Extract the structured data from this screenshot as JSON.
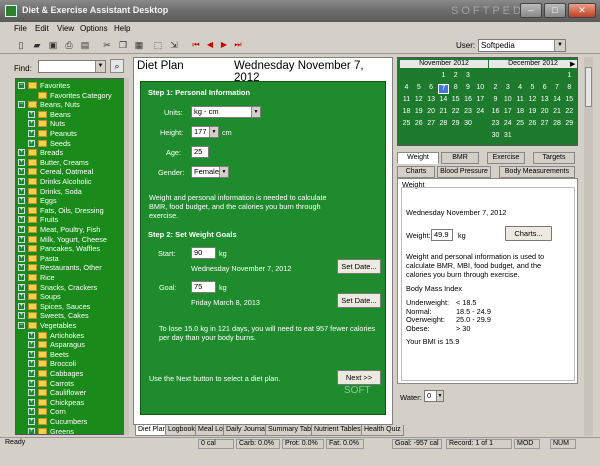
{
  "window": {
    "title": "Diet & Exercise Assistant Desktop",
    "watermark": "SOFTPEDIA",
    "watermark_small": "SOFT"
  },
  "menu": [
    "File",
    "Edit",
    "View",
    "Options",
    "Help"
  ],
  "user": {
    "label": "User:",
    "value": "Softpedia"
  },
  "find": {
    "label": "Find:"
  },
  "tree": [
    {
      "label": "Favorites",
      "level": 0,
      "expanded": true
    },
    {
      "label": "Favorites Category",
      "level": 1
    },
    {
      "label": "Beans, Nuts",
      "level": 0,
      "expanded": true
    },
    {
      "label": "Beans",
      "level": 1,
      "expandable": true
    },
    {
      "label": "Nuts",
      "level": 1,
      "expandable": true
    },
    {
      "label": "Peanuts",
      "level": 1,
      "expandable": true
    },
    {
      "label": "Seeds",
      "level": 1,
      "expandable": true
    },
    {
      "label": "Breads",
      "level": 0
    },
    {
      "label": "Butter, Creams",
      "level": 0
    },
    {
      "label": "Cereal, Oatmeal",
      "level": 0
    },
    {
      "label": "Drinks Alcoholic",
      "level": 0
    },
    {
      "label": "Drinks, Soda",
      "level": 0
    },
    {
      "label": "Eggs",
      "level": 0
    },
    {
      "label": "Fats, Oils, Dressing",
      "level": 0
    },
    {
      "label": "Fruits",
      "level": 0
    },
    {
      "label": "Meat, Poultry, Fish",
      "level": 0
    },
    {
      "label": "Milk, Yogurt, Cheese",
      "level": 0
    },
    {
      "label": "Pancakes, Waffles",
      "level": 0
    },
    {
      "label": "Pasta",
      "level": 0
    },
    {
      "label": "Restaurants, Other",
      "level": 0
    },
    {
      "label": "Rice",
      "level": 0
    },
    {
      "label": "Snacks, Crackers",
      "level": 0
    },
    {
      "label": "Soups",
      "level": 0
    },
    {
      "label": "Spices, Sauces",
      "level": 0
    },
    {
      "label": "Sweets, Cakes",
      "level": 0
    },
    {
      "label": "Vegetables",
      "level": 0,
      "expanded": true
    },
    {
      "label": "Artichokes",
      "level": 1,
      "expandable": true
    },
    {
      "label": "Asparagus",
      "level": 1,
      "expandable": true
    },
    {
      "label": "Beets",
      "level": 1,
      "expandable": true
    },
    {
      "label": "Broccoli",
      "level": 1,
      "expandable": true
    },
    {
      "label": "Cabbages",
      "level": 1,
      "expandable": true
    },
    {
      "label": "Carrots",
      "level": 1,
      "expandable": true
    },
    {
      "label": "Cauliflower",
      "level": 1,
      "expandable": true
    },
    {
      "label": "Chickpeas",
      "level": 1,
      "expandable": true
    },
    {
      "label": "Corn",
      "level": 1,
      "expandable": true
    },
    {
      "label": "Cucumbers",
      "level": 1,
      "expandable": true
    },
    {
      "label": "Greens",
      "level": 1,
      "expandable": true
    }
  ],
  "diet": {
    "title": "Diet Plan",
    "date": "Wednesday November 7, 2012",
    "step1": "Step 1:  Personal Information",
    "units_label": "Units:",
    "units_value": "kg - cm",
    "height_label": "Height:",
    "height_value": "177",
    "height_unit": "cm",
    "age_label": "Age:",
    "age_value": "25",
    "gender_label": "Gender:",
    "gender_value": "Female",
    "step1_note": "Weight and personal information is needed to calculate BMR, food budget, and the calories you burn through exercise.",
    "step2": "Step 2:  Set Weight Goals",
    "start_label": "Start:",
    "start_value": "90",
    "start_unit": "kg",
    "start_date": "Wednesday November 7, 2012",
    "goal_label": "Goal:",
    "goal_value": "75",
    "goal_unit": "kg",
    "goal_date": "Friday March 8, 2013",
    "set_date": "Set Date...",
    "summary": "To lose 15.0 kg in 121 days, you will need to eat 957 fewer calories per day than your body burns.",
    "next_note": "Use the Next button to select a diet plan.",
    "next_button": "Next >>"
  },
  "center_tabs": [
    "Diet Plan",
    "Logbook",
    "Meal Log",
    "Daily Journal",
    "Summary Table",
    "Nutrient Tables",
    "Health Quiz"
  ],
  "calendar": {
    "nov_title": "November 2012",
    "dec_title": "December 2012",
    "nov_rows": [
      [
        "",
        "",
        "",
        "1",
        "2",
        "3"
      ],
      [
        "4",
        "5",
        "6",
        "7",
        "8",
        "9",
        "10"
      ],
      [
        "11",
        "12",
        "13",
        "14",
        "15",
        "16",
        "17"
      ],
      [
        "18",
        "19",
        "20",
        "21",
        "22",
        "23",
        "24"
      ],
      [
        "25",
        "26",
        "27",
        "28",
        "29",
        "30"
      ]
    ],
    "dec_rows": [
      [
        "",
        "",
        "",
        "",
        "",
        "",
        "1"
      ],
      [
        "2",
        "3",
        "4",
        "5",
        "6",
        "7",
        "8"
      ],
      [
        "9",
        "10",
        "11",
        "12",
        "13",
        "14",
        "15"
      ],
      [
        "16",
        "17",
        "18",
        "19",
        "20",
        "21",
        "22"
      ],
      [
        "23",
        "24",
        "25",
        "26",
        "27",
        "28",
        "29"
      ],
      [
        "30",
        "31"
      ]
    ],
    "selected": "7"
  },
  "right_tabs_row1": [
    "Weight",
    "BMR",
    "Exercise",
    "Targets"
  ],
  "right_tabs_row2": [
    "Charts",
    "Blood Pressure",
    "Body Measurements"
  ],
  "weight_panel": {
    "group": "Weight",
    "date": "Wednesday November 7, 2012",
    "weight_label": "Weight:",
    "weight_value": "49.9",
    "weight_unit": "kg",
    "charts_button": "Charts...",
    "note": "Weight and personal information is used to calculate BMR, MBI, food budget, and the calories you burn through exercise.",
    "bmi_title": "Body Mass Index",
    "bmi_rows": [
      [
        "Underweight:",
        "< 18.5"
      ],
      [
        "Normal:",
        "18.5 - 24.9"
      ],
      [
        "Overweight:",
        "25.0 - 29.9"
      ],
      [
        "Obese:",
        "> 30"
      ]
    ],
    "your_bmi": "Your BMI is 15.9"
  },
  "water": {
    "label": "Water:",
    "value": "0"
  },
  "status": [
    "Ready",
    "0 cal",
    "Carb: 0.0%",
    "Prot: 0.0%",
    "Fat: 0.0%",
    "Goal: -957 cal",
    "Record: 1 of 1",
    "MOD",
    "NUM"
  ]
}
